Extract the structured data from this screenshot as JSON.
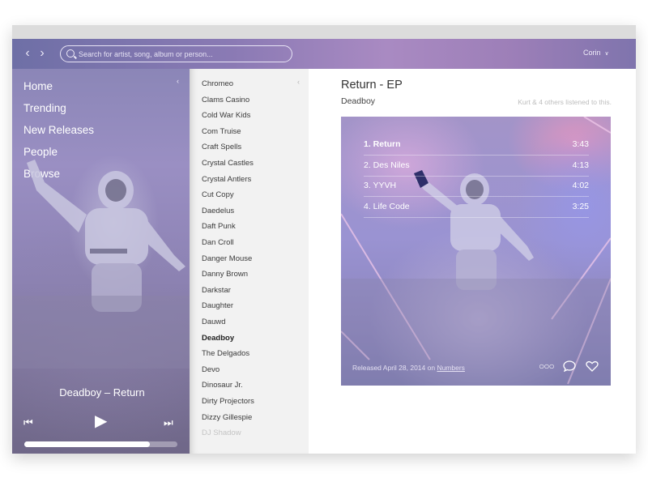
{
  "topbar": {
    "back_icon": "chevron-left-icon",
    "forward_icon": "chevron-right-icon",
    "search_placeholder": "Search for artist, song, album or person...",
    "user_name": "Corin"
  },
  "sidebar": {
    "items": [
      {
        "label": "Home"
      },
      {
        "label": "Trending"
      },
      {
        "label": "New Releases"
      },
      {
        "label": "People"
      },
      {
        "label": "Browse"
      }
    ],
    "now_playing": "Deadboy – Return",
    "progress": 0.82
  },
  "artists": [
    "Chromeo",
    "Clams Casino",
    "Cold War Kids",
    "Com Truise",
    "Craft Spells",
    "Crystal Castles",
    "Crystal Antlers",
    "Cut Copy",
    "Daedelus",
    "Daft Punk",
    "Dan Croll",
    "Danger Mouse",
    "Danny Brown",
    "Darkstar",
    "Daughter",
    "Dauwd",
    "Deadboy",
    "The Delgados",
    "Devo",
    "Dinosaur Jr.",
    "Dirty Projectors",
    "Dizzy Gillespie",
    "DJ Shadow"
  ],
  "selected_artist": "Deadboy",
  "album": {
    "title": "Return - EP",
    "artist": "Deadboy",
    "listened": "Kurt & 4 others listened to this.",
    "tracks": [
      {
        "name": "1. Return",
        "duration": "3:43"
      },
      {
        "name": "2. Des Niles",
        "duration": "4:13"
      },
      {
        "name": "3. YYVH",
        "duration": "4:02"
      },
      {
        "name": "4. Life Code",
        "duration": "3:25"
      }
    ],
    "release_prefix": "Released April 28, 2014 on ",
    "release_label": "Numbers"
  },
  "colors": {
    "topbar_gradient": [
      "#6e6fa6",
      "#a98ac2"
    ],
    "artist_list_bg": "#f2f2f2",
    "text_dark": "#333333",
    "muted": "#bdbdbd"
  }
}
